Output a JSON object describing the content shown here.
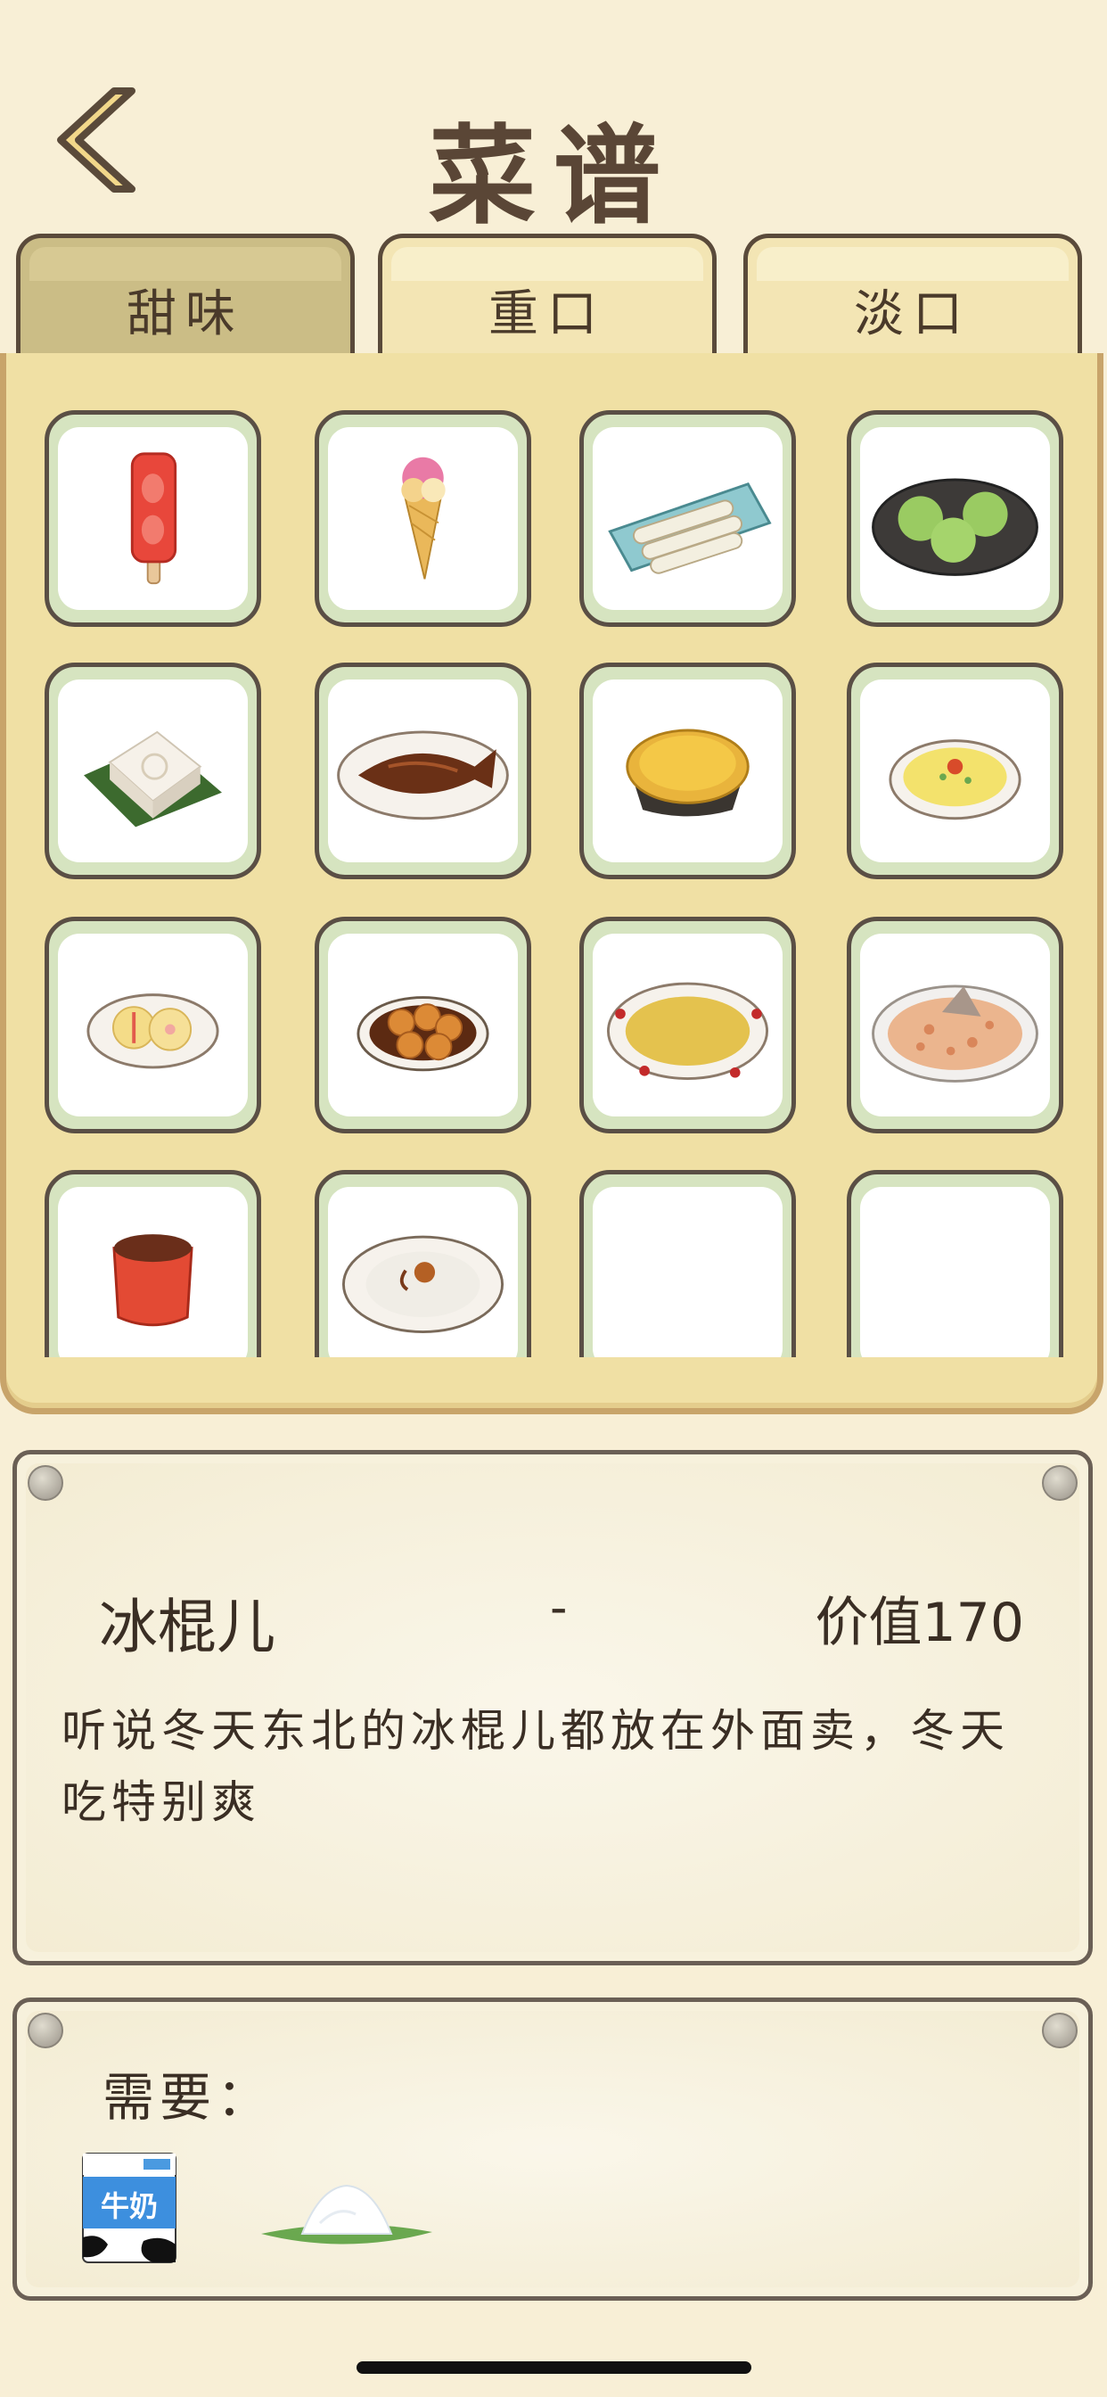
{
  "header": {
    "title": "菜谱",
    "back_icon": "chevron-left-icon"
  },
  "tabs": [
    {
      "label": "甜味",
      "active": true
    },
    {
      "label": "重口",
      "active": false
    },
    {
      "label": "淡口",
      "active": false
    }
  ],
  "recipes": [
    {
      "icon": "popsicle-icon"
    },
    {
      "icon": "ice-cream-cone-icon"
    },
    {
      "icon": "rice-rolls-icon"
    },
    {
      "icon": "green-dumplings-icon"
    },
    {
      "icon": "white-cake-icon"
    },
    {
      "icon": "braised-fish-icon"
    },
    {
      "icon": "egg-tart-icon"
    },
    {
      "icon": "omelette-icon"
    },
    {
      "icon": "pancakes-icon"
    },
    {
      "icon": "glazed-balls-icon"
    },
    {
      "icon": "soup-plate-icon"
    },
    {
      "icon": "fried-rice-icon"
    },
    {
      "icon": "red-bean-cup-icon"
    },
    {
      "icon": "rice-pudding-icon"
    },
    {
      "icon": ""
    },
    {
      "icon": ""
    }
  ],
  "detail": {
    "name": "冰棍儿",
    "separator": "-",
    "price": "价值170",
    "description": "听说冬天东北的冰棍儿都放在外面卖，冬天吃特别爽"
  },
  "requirements": {
    "label": "需要：",
    "items": [
      {
        "icon": "milk-carton-icon",
        "text": "牛奶"
      },
      {
        "icon": "sugar-pile-icon"
      }
    ]
  }
}
